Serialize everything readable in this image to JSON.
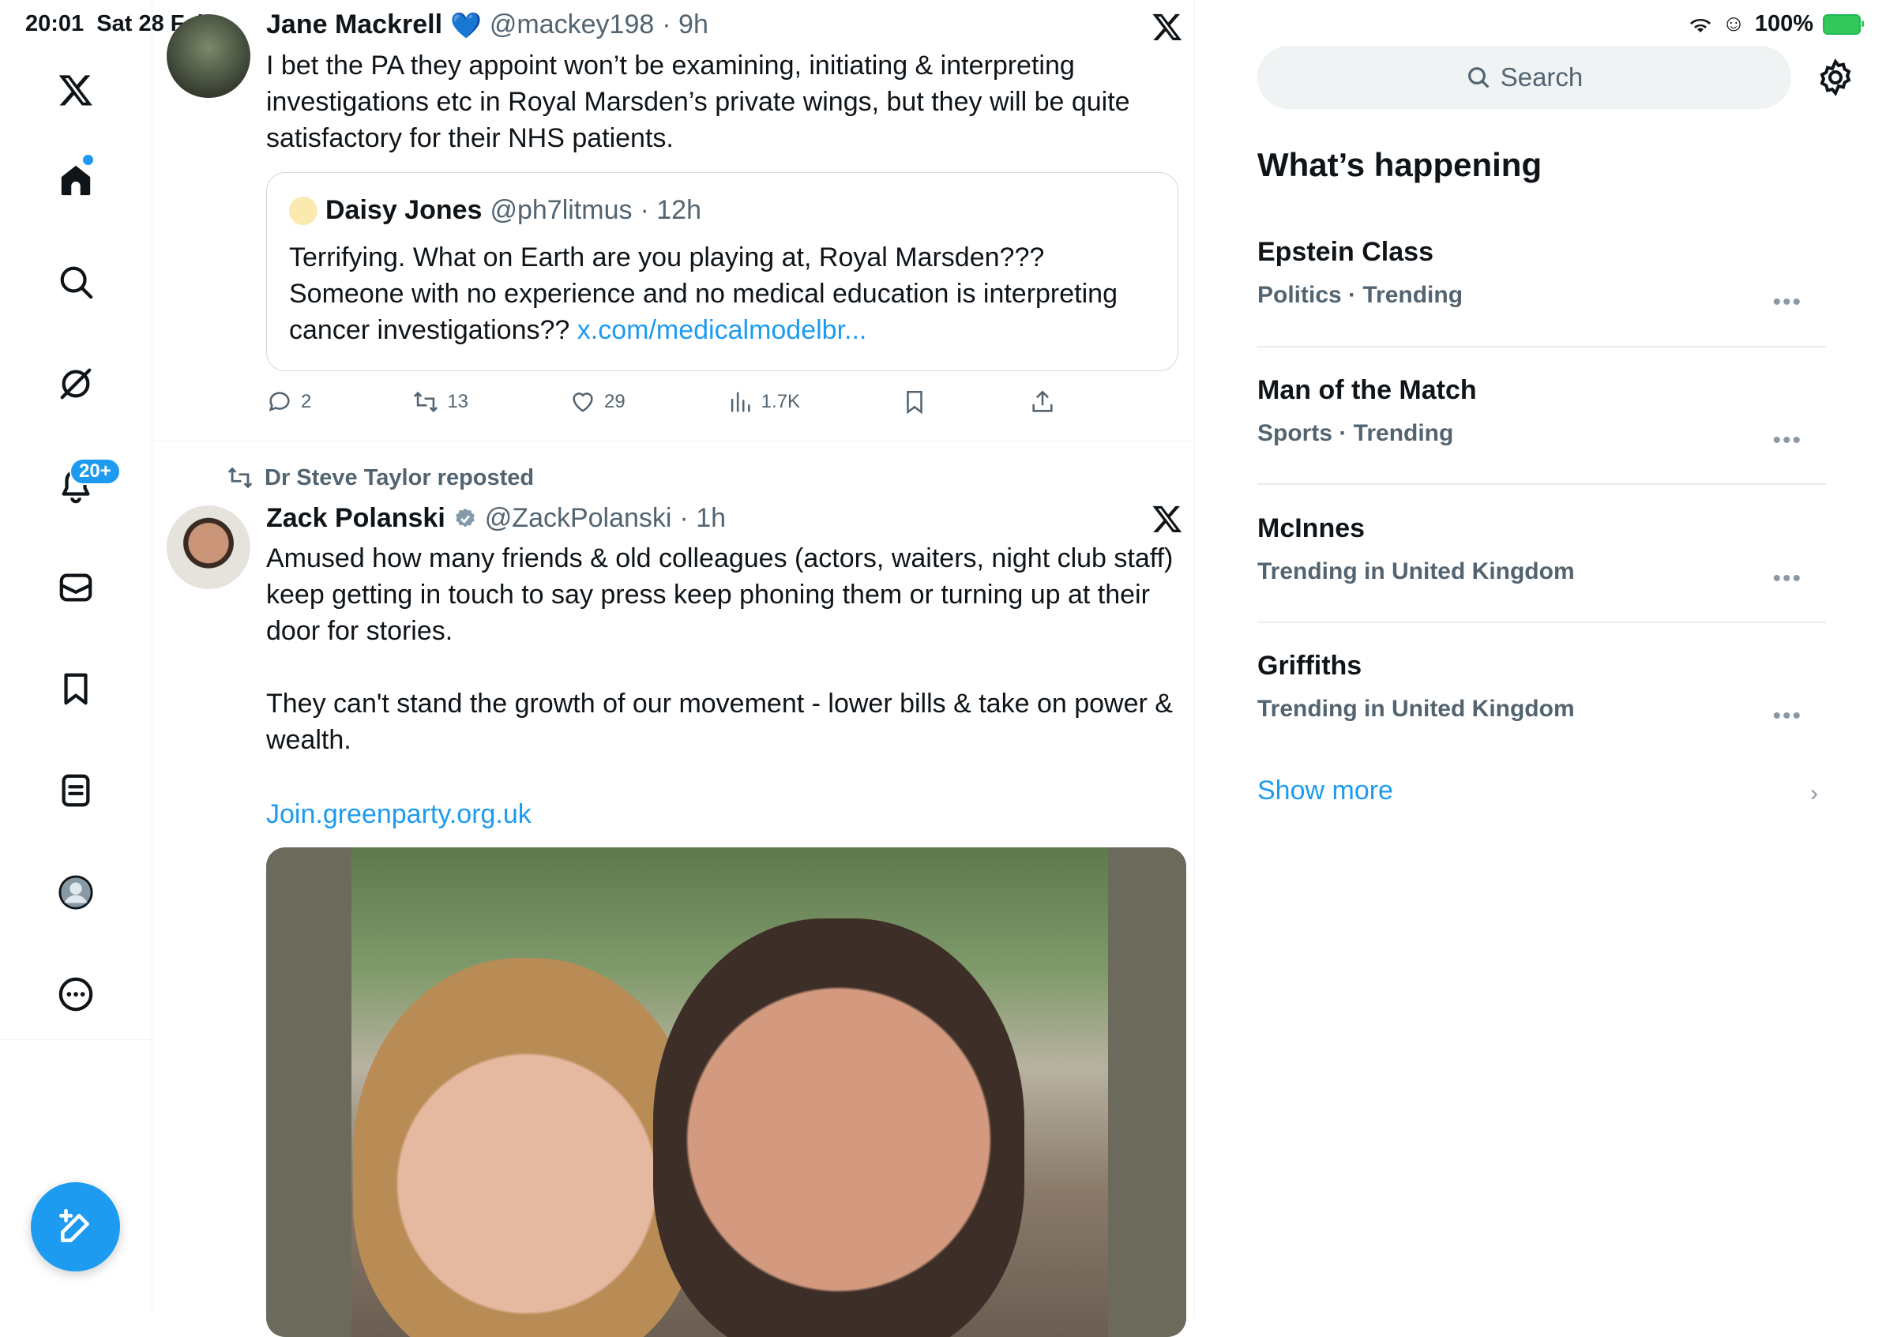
{
  "status_bar": {
    "time": "20:01",
    "date": "Sat 28 Feb",
    "battery": "100%"
  },
  "nav": {
    "items": [
      "x-logo",
      "home",
      "explore",
      "grok",
      "notifications",
      "messages",
      "bookmarks",
      "lists",
      "profile",
      "more"
    ],
    "notifications_badge": "20+"
  },
  "tweets": [
    {
      "name": "Jane Mackrell",
      "emoji": "💙",
      "handle": "@mackey198",
      "time": "· 9h",
      "text": "I bet the PA they appoint won’t be examining, initiating & interpreting investigations etc in Royal Marsden’s private wings, but they will be quite satisfactory for their NHS patients.",
      "quote": {
        "name": "Daisy Jones",
        "handle": "@ph7litmus",
        "time": "· 12h",
        "text": "Terrifying. What on Earth are you playing at, Royal Marsden??? Someone with no experience and no medical education is interpreting cancer investigations??",
        "link": "x.com/medicalmodelbr..."
      },
      "stats": {
        "replies": "2",
        "reposts": "13",
        "likes": "29",
        "views": "1.7K"
      }
    },
    {
      "reposted_by": "Dr Steve Taylor reposted",
      "name": "Zack Polanski",
      "handle": "@ZackPolanski",
      "time": "· 1h",
      "text1": "Amused how many friends & old colleagues (actors, waiters, night club staff) keep getting in touch to say press keep phoning them or turning up at their door for stories.",
      "text2": "They can't stand the growth of our movement - lower bills & take on power & wealth.",
      "link": "Join.greenparty.org.uk"
    }
  ],
  "search": {
    "placeholder": "Search"
  },
  "whats_happening": {
    "title": "What’s happening",
    "trends": [
      {
        "name": "Epstein Class",
        "meta": "Politics · Trending"
      },
      {
        "name": "Man of the Match",
        "meta": "Sports · Trending"
      },
      {
        "name": "McInnes",
        "meta": "Trending in United Kingdom"
      },
      {
        "name": "Griffiths",
        "meta": "Trending in United Kingdom"
      }
    ],
    "show_more": "Show more"
  },
  "colors": {
    "accent": "#1d9bf0",
    "secondary_text": "#536471",
    "border": "#eff3f4"
  }
}
